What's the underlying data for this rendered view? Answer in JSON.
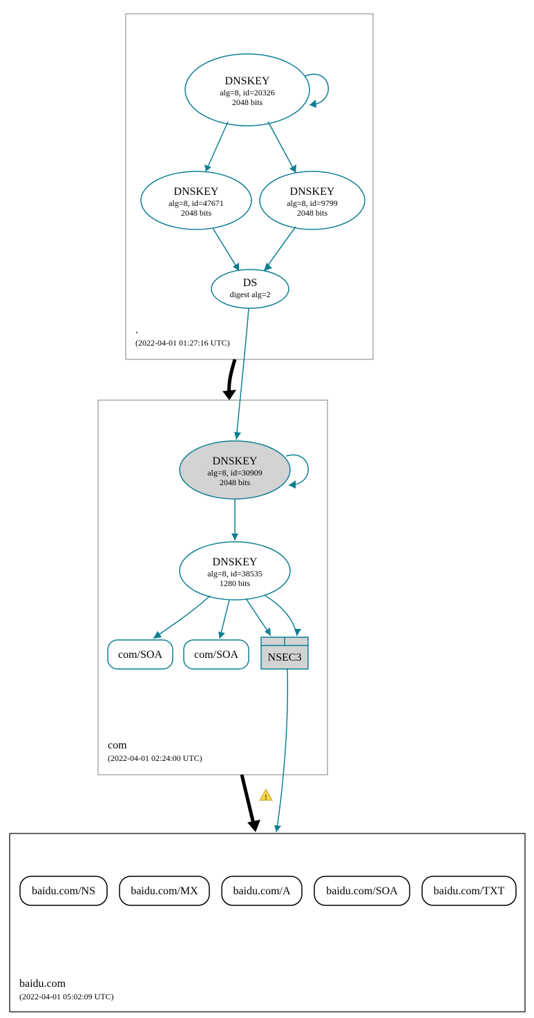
{
  "colors": {
    "teal": "#0d7e93",
    "grayFill": "#d3d3d3",
    "boxGray": "#808080",
    "black": "#000000"
  },
  "zones": {
    "root": {
      "label": ".",
      "time": "(2022-04-01 01:27:16 UTC)"
    },
    "com": {
      "label": "com",
      "time": "(2022-04-01 02:24:00 UTC)"
    },
    "baidu": {
      "label": "baidu.com",
      "time": "(2022-04-01 05:02:09 UTC)"
    }
  },
  "nodes": {
    "root_ksk": {
      "title": "DNSKEY",
      "line2": "alg=8, id=20326",
      "line3": "2048 bits"
    },
    "root_zsk1": {
      "title": "DNSKEY",
      "line2": "alg=8, id=47671",
      "line3": "2048 bits"
    },
    "root_zsk2": {
      "title": "DNSKEY",
      "line2": "alg=8, id=9799",
      "line3": "2048 bits"
    },
    "root_ds": {
      "title": "DS",
      "line2": "digest alg=2"
    },
    "com_ksk": {
      "title": "DNSKEY",
      "line2": "alg=8, id=30909",
      "line3": "2048 bits"
    },
    "com_zsk": {
      "title": "DNSKEY",
      "line2": "alg=8, id=38535",
      "line3": "1280 bits"
    },
    "com_soa1": {
      "label": "com/SOA"
    },
    "com_soa2": {
      "label": "com/SOA"
    },
    "nsec3": {
      "label": "NSEC3"
    },
    "baidu_ns": {
      "label": "baidu.com/NS"
    },
    "baidu_mx": {
      "label": "baidu.com/MX"
    },
    "baidu_a": {
      "label": "baidu.com/A"
    },
    "baidu_soa": {
      "label": "baidu.com/SOA"
    },
    "baidu_txt": {
      "label": "baidu.com/TXT"
    }
  }
}
